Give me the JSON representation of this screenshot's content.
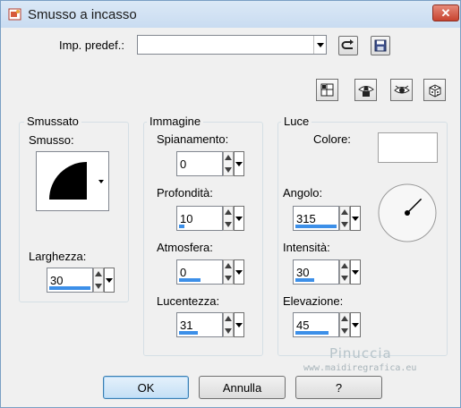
{
  "window": {
    "title": "Smusso a incasso",
    "close_glyph": "✕"
  },
  "preset": {
    "label": "Imp. predef.:",
    "value": ""
  },
  "groups": {
    "bevel": {
      "title": "Smussato",
      "shape_label": "Smusso:",
      "width_label": "Larghezza:",
      "width_value": "30",
      "width_level": 1.0
    },
    "image": {
      "title": "Immagine",
      "smoothness_label": "Spianamento:",
      "smoothness_value": "0",
      "depth_label": "Profondità:",
      "depth_value": "10",
      "ambience_label": "Atmosfera:",
      "ambience_value": "0",
      "shininess_label": "Lucentezza:",
      "shininess_value": "31"
    },
    "light": {
      "title": "Luce",
      "color_label": "Colore:",
      "color_value": "#ffffff",
      "angle_label": "Angolo:",
      "angle_value": "315",
      "intensity_label": "Intensità:",
      "intensity_value": "30",
      "elevation_label": "Elevazione:",
      "elevation_value": "45"
    }
  },
  "buttons": {
    "ok": "OK",
    "cancel": "Annulla",
    "help": "?"
  },
  "watermark": {
    "name": "Pinuccia",
    "site": "www.maidiregrafica.eu"
  },
  "colors": {
    "accent": "#3c8fe8",
    "window_bg": "#f0f0f0"
  }
}
